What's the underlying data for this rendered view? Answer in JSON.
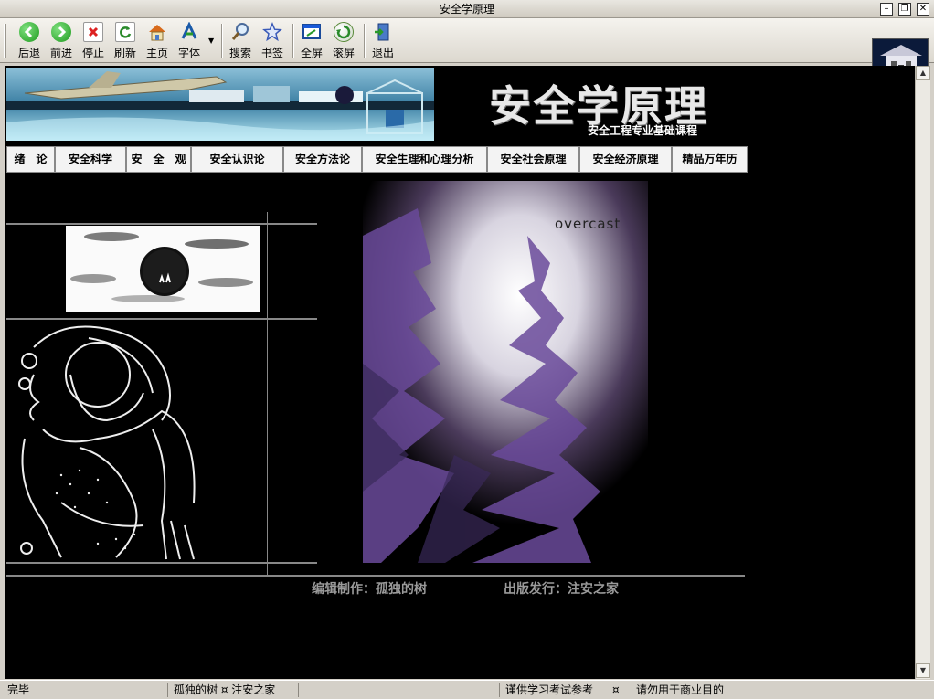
{
  "window": {
    "title": "安全学原理"
  },
  "toolbar": {
    "back": "后退",
    "forward": "前进",
    "stop": "停止",
    "refresh": "刷新",
    "home": "主页",
    "font": "字体",
    "search": "搜索",
    "bookmark": "书签",
    "fullscreen": "全屏",
    "scroll": "滚屏",
    "exit": "退出"
  },
  "page": {
    "title": "安全学原理",
    "subtitle": "安全工程专业基础课程",
    "menu": [
      "绪　论",
      "安全科学",
      "安　全　观",
      "安全认识论",
      "安全方法论",
      "安全生理和心理分析",
      "安全社会原理",
      "安全经济原理",
      "精品万年历"
    ],
    "photo_caption": "overcast",
    "credit_editor": "编辑制作：孤独的树",
    "credit_publisher": "出版发行：注安之家"
  },
  "status": {
    "state": "完毕",
    "author": "孤独的树 ¤ 注安之家",
    "notice_left": "谨供学习考试参考",
    "separator": "¤",
    "notice_right": "请勿用于商业目的"
  },
  "colors": {
    "background": "#000000",
    "chrome": "#d4d0c8",
    "accent_purple": "#6a4a9a"
  }
}
